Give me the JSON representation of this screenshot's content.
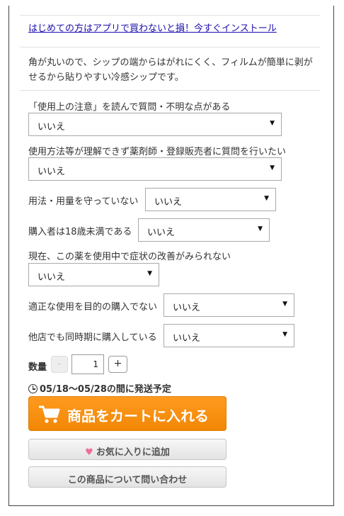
{
  "app_promo_link": "はじめての方はアプリで買わないと損！今すぐインストール",
  "description": "角が丸いので、シップの端からはがれにくく、フィルムが簡単に剥がせるから貼りやすい冷感シップです。",
  "questions": [
    {
      "label": "「使用上の注意」を読んで質問・不明な点がある",
      "value": "いいえ"
    },
    {
      "label": "使用方法等が理解できず薬剤師・登録販売者に質問を行いたい",
      "value": "いいえ"
    },
    {
      "label": "用法・用量を守っていない",
      "value": "いいえ"
    },
    {
      "label": "購入者は18歳未満である",
      "value": "いいえ"
    },
    {
      "label": "現在、この薬を使用中で症状の改善がみられない",
      "value": "いいえ"
    },
    {
      "label": "適正な使用を目的の購入でない",
      "value": "いいえ"
    },
    {
      "label": "他店でも同時期に購入している",
      "value": "いいえ"
    }
  ],
  "quantity": {
    "label": "数量",
    "minus": "-",
    "value": "1",
    "plus": "+"
  },
  "shipping": {
    "icon": "clock-icon",
    "text": "05/18〜05/28の間に発送予定"
  },
  "buttons": {
    "add_to_cart": "商品をカートに入れる",
    "add_to_cart_icon": "cart-icon",
    "favorite": "お気に入りに追加",
    "favorite_icon": "heart-icon",
    "inquiry": "この商品について問い合わせ"
  },
  "colors": {
    "link": "#1a0dab",
    "cart_button": "#f28705",
    "heart": "#ee6f9a"
  }
}
